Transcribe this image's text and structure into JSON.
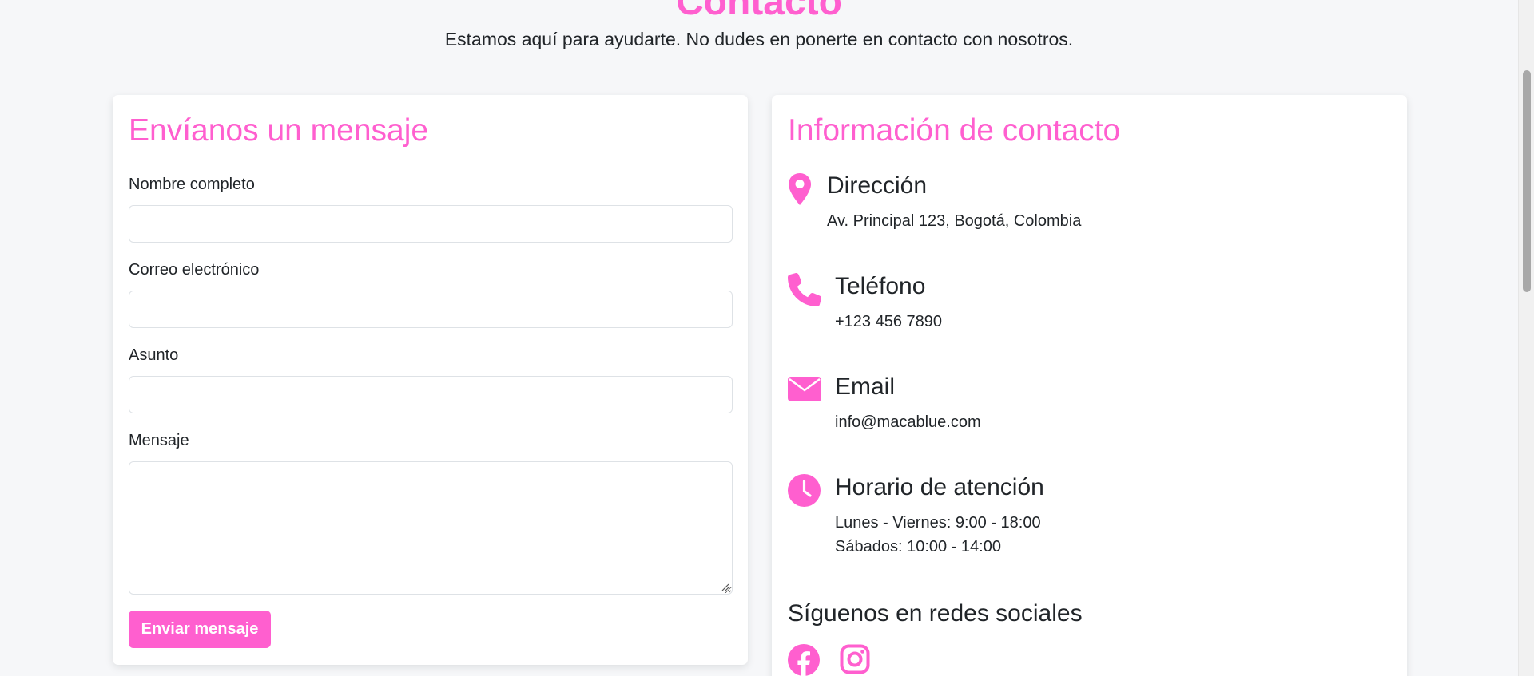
{
  "header": {
    "title": "Contacto",
    "subtitle": "Estamos aquí para ayudarte. No dudes en ponerte en contacto con nosotros."
  },
  "form": {
    "heading": "Envíanos un mensaje",
    "fields": [
      {
        "label": "Nombre completo",
        "value": "",
        "placeholder": ""
      },
      {
        "label": "Correo electrónico",
        "value": "",
        "placeholder": ""
      },
      {
        "label": "Asunto",
        "value": "",
        "placeholder": ""
      },
      {
        "label": "Mensaje",
        "value": "",
        "placeholder": ""
      }
    ],
    "submit_label": "Enviar mensaje"
  },
  "info": {
    "heading": "Información de contacto",
    "items": [
      {
        "icon": "map-pin-icon",
        "title": "Dirección",
        "lines": [
          "Av. Principal 123, Bogotá, Colombia"
        ]
      },
      {
        "icon": "phone-icon",
        "title": "Teléfono",
        "lines": [
          "+123 456 7890"
        ]
      },
      {
        "icon": "envelope-icon",
        "title": "Email",
        "lines": [
          "info@macablue.com"
        ]
      },
      {
        "icon": "clock-icon",
        "title": "Horario de atención",
        "lines": [
          "Lunes - Viernes: 9:00 - 18:00",
          "Sábados: 10:00 - 14:00"
        ]
      }
    ],
    "social_heading": "Síguenos en redes sociales",
    "social": [
      {
        "icon": "facebook-icon"
      },
      {
        "icon": "instagram-icon"
      }
    ]
  },
  "colors": {
    "accent": "#ff5fcf",
    "page_background": "#f6f7f9",
    "text": "#212529"
  }
}
